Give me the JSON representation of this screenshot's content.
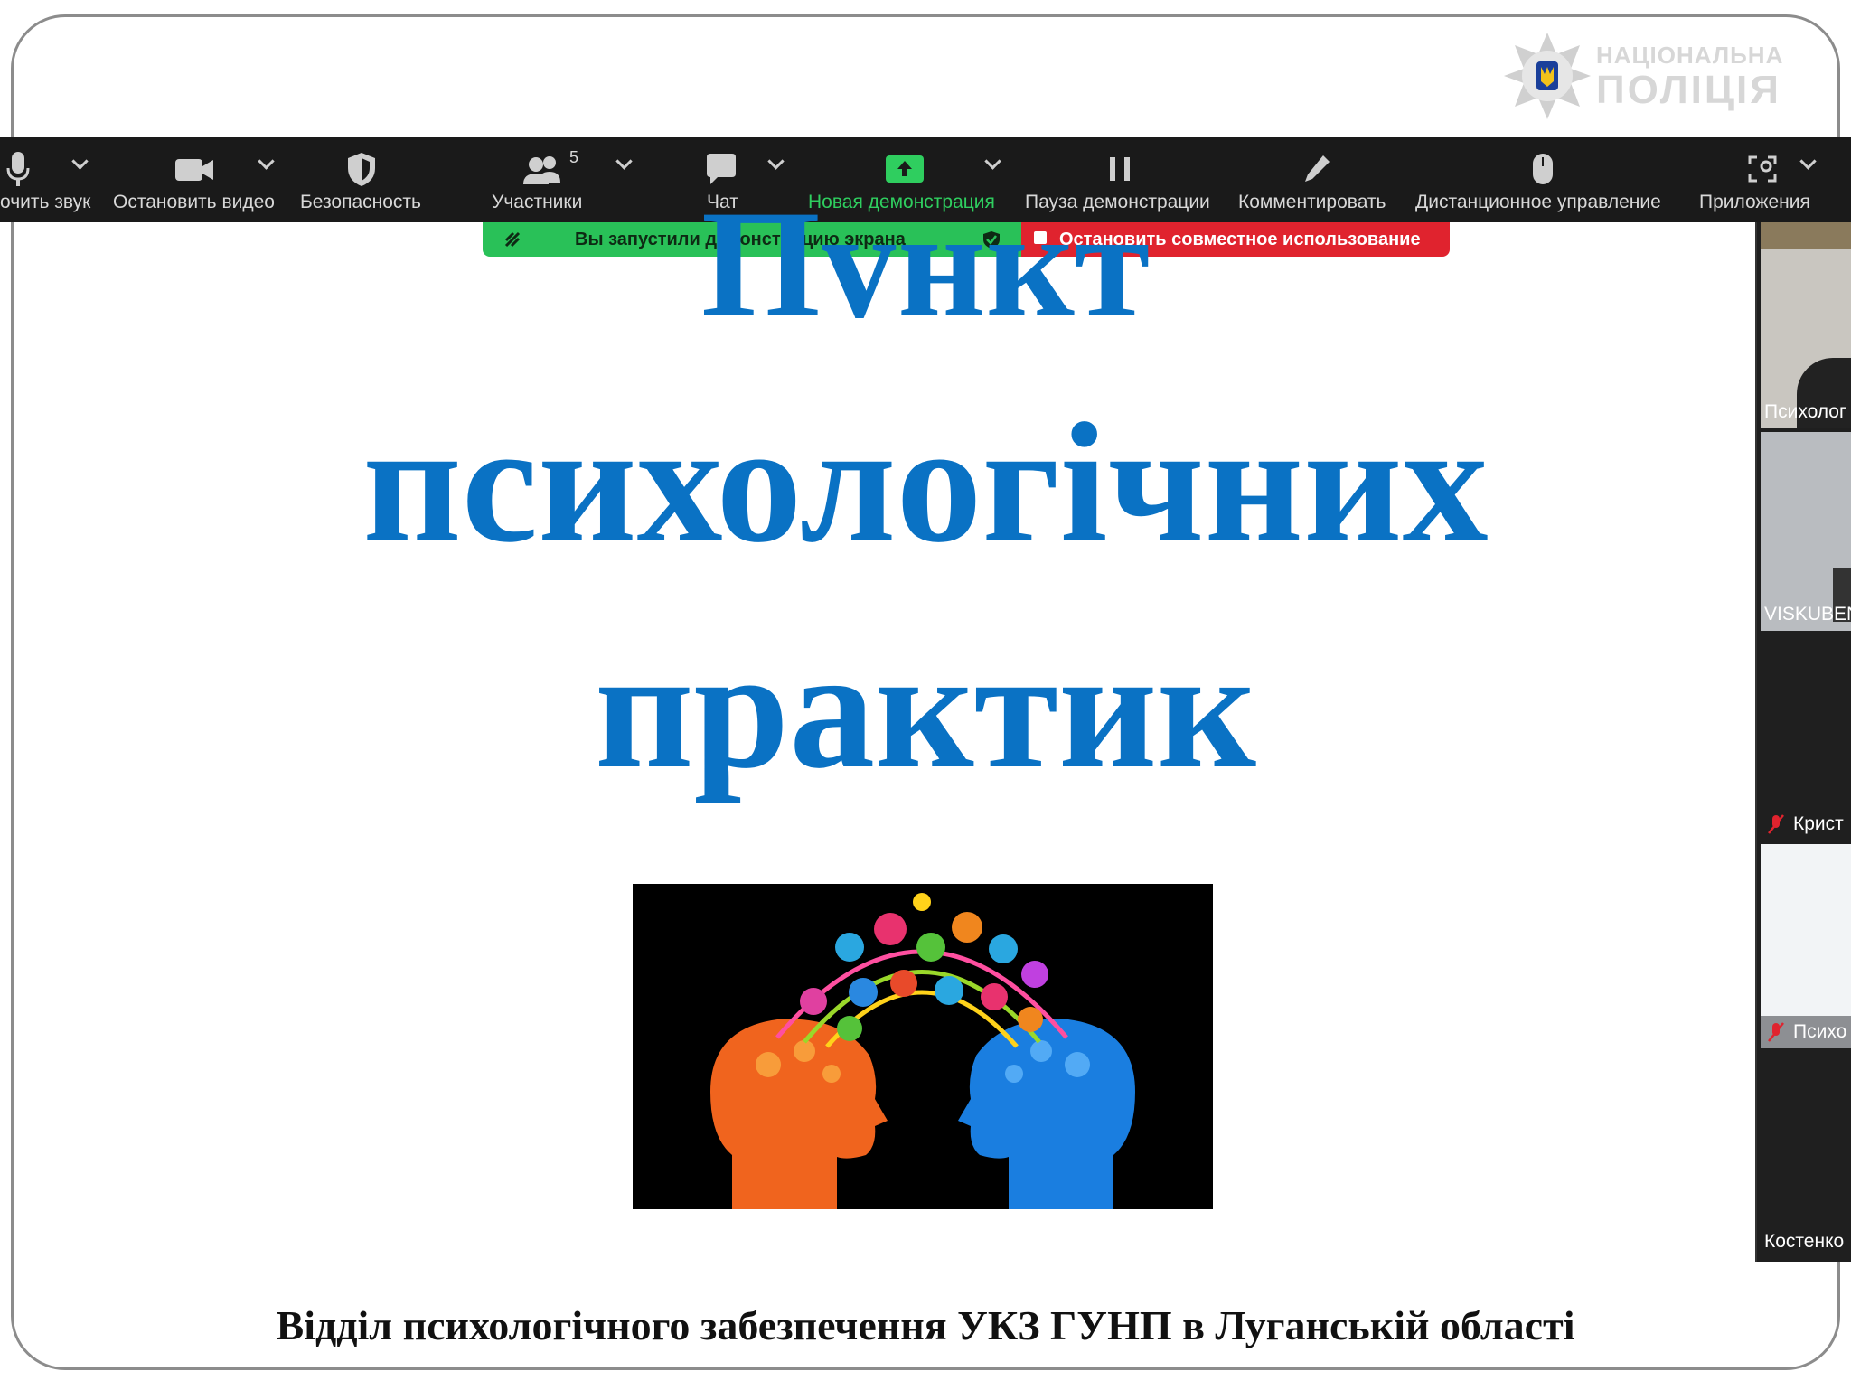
{
  "logo": {
    "line1": "НАЦІОНАЛЬНА",
    "line2": "ПОЛІЦІЯ"
  },
  "toolbar": {
    "audio_label": "очить звук",
    "video_label": "Остановить видео",
    "security_label": "Безопасность",
    "participants_label": "Участники",
    "participants_count": "5",
    "chat_label": "Чат",
    "new_share_label": "Новая демонстрация",
    "pause_label": "Пауза демонстрации",
    "annotate_label": "Комментировать",
    "remote_label": "Дистанционное управление",
    "apps_label": "Приложения"
  },
  "share_banner": {
    "status": "Вы запустили демонстрацию экрана",
    "stop_label": "Остановить совместное использование"
  },
  "slide": {
    "title_line1": "Пункт",
    "title_line2": "психологічних",
    "title_line3": "практик",
    "footer": "Відділ психологічного забезпечення УКЗ ГУНП в Луганській області"
  },
  "participants": [
    {
      "name": "Психолог",
      "muted": false
    },
    {
      "name": "VISKUBEN",
      "muted": false
    },
    {
      "name": "Крист",
      "muted": true
    },
    {
      "name": "Психо",
      "muted": true
    },
    {
      "name": "Костенко",
      "muted": false
    }
  ],
  "colors": {
    "title_blue": "#0a72c4",
    "toolbar_bg": "#1a1a1a",
    "share_green": "#29c158",
    "stop_red": "#e0232e"
  }
}
